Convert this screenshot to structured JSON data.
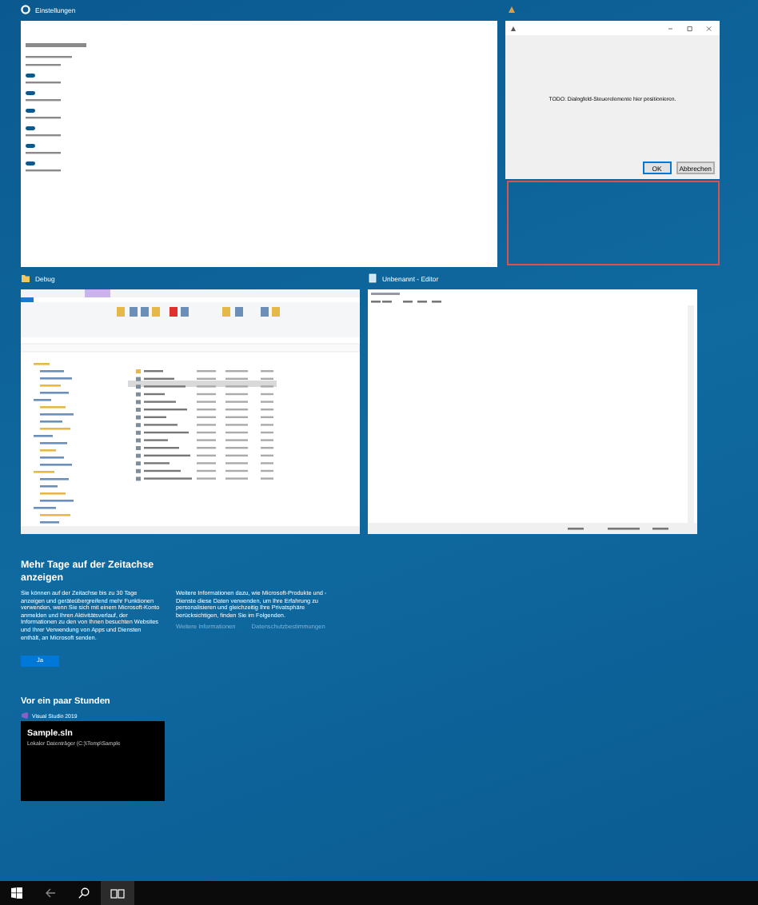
{
  "windows": [
    {
      "kind": "settings",
      "title": "Einstellungen"
    },
    {
      "kind": "dialog",
      "message": "TODO: Dialogfeld-Steuerelemente hier positionieren.",
      "buttons": [
        "OK",
        "Abbrechen"
      ]
    },
    {
      "kind": "explorer",
      "title": "Debug"
    },
    {
      "kind": "editor",
      "title": "Unbenannt - Editor"
    }
  ],
  "timeline": {
    "heading": "Mehr Tage auf der Zeitachse anzeigen",
    "paragraphs": [
      "Sie können auf der Zeitachse bis zu 30 Tage anzeigen und geräteübergreifend mehr Funktionen verwenden, wenn Sie sich mit einem Microsoft-Konto anmelden und Ihren Aktivitätsverlauf, der Informationen zu den von Ihnen besuchten Websites und Ihrer Verwendung von Apps und Diensten enthält, an Microsoft senden.",
      "Weitere Informationen dazu, wie Microsoft-Produkte und -Dienste diese Daten verwenden, um Ihre Erfahrung zu personalisieren und gleichzeitig Ihre Privatsphäre berücksichtigen, finden Sie im Folgenden."
    ],
    "links": [
      "Weitere Informationen",
      "Datenschutzbestimmungen"
    ],
    "button": "Ja"
  },
  "recent": {
    "heading": "Vor ein paar Stunden",
    "activities": [
      {
        "app": "Visual Studio 2019",
        "title": "Sample.sln",
        "path": "Lokaler Datenträger (C:)\\Temp\\Sample"
      }
    ]
  }
}
